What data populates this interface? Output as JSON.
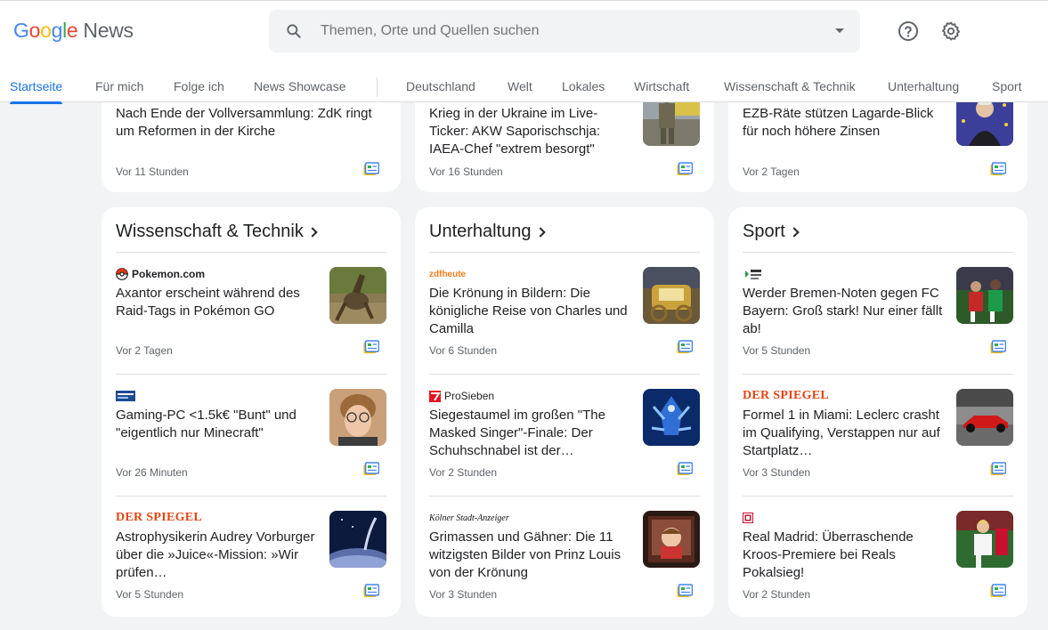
{
  "header": {
    "logo_brand": "Google",
    "logo_product": "News",
    "search_placeholder": "Themen, Orte und Quellen suchen"
  },
  "nav": {
    "tabs": [
      "Startseite",
      "Für mich",
      "Folge ich",
      "News Showcase",
      "Deutschland",
      "Welt",
      "Lokales",
      "Wirtschaft",
      "Wissenschaft & Technik",
      "Unterhaltung",
      "Sport"
    ],
    "active": "Startseite"
  },
  "top_row": [
    {
      "headline": "Nach Ende der Vollversammlung: ZdK ringt um Reformen in der Kirche",
      "time": "Vor 11 Stunden",
      "thumb": "none"
    },
    {
      "headline": "Krieg in der Ukraine im Live-Ticker: AKW Saporischschja: IAEA-Chef \"extrem besorgt\"",
      "time": "Vor 16 Stunden",
      "thumb": "soldier"
    },
    {
      "headline": "EZB-Räte stützen Lagarde-Blick für noch höhere Zinsen",
      "time": "Vor 2 Tagen",
      "thumb": "eu-flag-person"
    }
  ],
  "sections": [
    {
      "title": "Wissenschaft & Technik",
      "stories": [
        {
          "source": "Pokemon.com",
          "source_logo": "pokeball-icon",
          "headline": "Axantor erscheint während des Raid-Tags in Pokémon GO",
          "time": "Vor 2 Tagen",
          "thumb": "dragon-creature"
        },
        {
          "source": "",
          "source_logo": "gamestar-logo",
          "headline": "Gaming-PC <1.5k€ \"Bunt\" und \"eigentlich nur Minecraft\"",
          "time": "Vor 26 Minuten",
          "thumb": "glasses-person"
        },
        {
          "source": "DER SPIEGEL",
          "source_logo": "spiegel-logo",
          "headline": "Astrophysikerin Audrey Vorburger über die »Juice«-Mission: »Wir prüfen…",
          "time": "Vor 5 Stunden",
          "thumb": "space-moon"
        }
      ]
    },
    {
      "title": "Unterhaltung",
      "stories": [
        {
          "source": "zdfheute",
          "source_logo": "zdf-logo",
          "headline": "Die Krönung in Bildern: Die königliche Reise von Charles und Camilla",
          "time": "Vor 6 Stunden",
          "thumb": "royal-carriage"
        },
        {
          "source": "ProSieben",
          "source_logo": "prosieben-icon",
          "headline": "Siegestaumel im großen \"The Masked Singer\"-Finale: Der Schuhschnabel ist der…",
          "time": "Vor 2 Stunden",
          "thumb": "blue-costume"
        },
        {
          "source": "Kölner Stadt-Anzeiger",
          "source_logo": "ksta-logo",
          "headline": "Grimassen und Gähner: Die 11 witzigsten Bilder von Prinz Louis von der Krönung",
          "time": "Vor 3 Stunden",
          "thumb": "child-window"
        }
      ]
    },
    {
      "title": "Sport",
      "stories": [
        {
          "source": "",
          "source_logo": "deichstube-logo",
          "headline": "Werder Bremen-Noten gegen FC Bayern: Groß stark! Nur einer fällt ab!",
          "time": "Vor 5 Stunden",
          "thumb": "football-green"
        },
        {
          "source": "DER SPIEGEL",
          "source_logo": "spiegel-logo",
          "headline": "Formel 1 in Miami: Leclerc crasht im Qualifying, Verstappen nur auf Startplatz…",
          "time": "Vor 3 Stunden",
          "thumb": "f1-car"
        },
        {
          "source": "",
          "source_logo": "kicker-icon",
          "headline": "Real Madrid: Überraschende Kroos-Premiere bei Reals Pokalsieg!",
          "time": "Vor 2 Stunden",
          "thumb": "football-white"
        }
      ]
    }
  ],
  "colors": {
    "accent": "#1a73e8",
    "background": "#f1f3f4",
    "spiegel": "#e64415"
  }
}
